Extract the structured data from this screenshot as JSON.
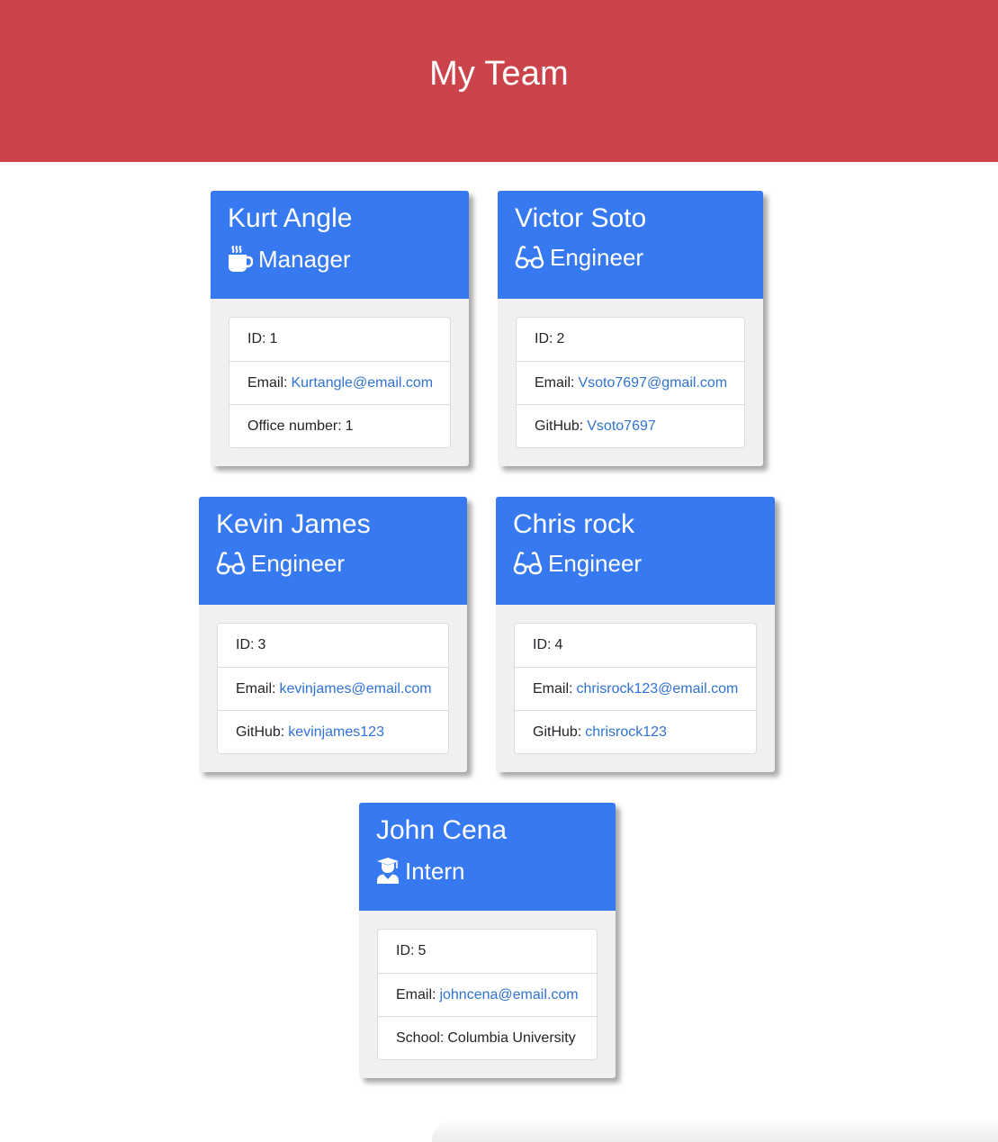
{
  "header": {
    "title": "My Team"
  },
  "cards": [
    {
      "name": "Kurt Angle",
      "role": "Manager",
      "icon": "mug-icon",
      "id_label": "ID:",
      "id_value": "1",
      "email_label": "Email:",
      "email_value": "Kurtangle@email.com",
      "extra_label": "Office number:",
      "extra_value": "1"
    },
    {
      "name": "Victor Soto",
      "role": "Engineer",
      "icon": "glasses-icon",
      "id_label": "ID:",
      "id_value": "2",
      "email_label": "Email:",
      "email_value": "Vsoto7697@gmail.com",
      "extra_label": "GitHub:",
      "extra_value": "Vsoto7697"
    },
    {
      "name": "Kevin James",
      "role": "Engineer",
      "icon": "glasses-icon",
      "id_label": "ID:",
      "id_value": "3",
      "email_label": "Email:",
      "email_value": "kevinjames@email.com",
      "extra_label": "GitHub:",
      "extra_value": "kevinjames123"
    },
    {
      "name": "Chris rock",
      "role": "Engineer",
      "icon": "glasses-icon",
      "id_label": "ID:",
      "id_value": "4",
      "email_label": "Email:",
      "email_value": "chrisrock123@email.com",
      "extra_label": "GitHub:",
      "extra_value": "chrisrock123"
    },
    {
      "name": "John Cena",
      "role": "Intern",
      "icon": "graduate-icon",
      "id_label": "ID:",
      "id_value": "5",
      "email_label": "Email:",
      "email_value": "johncena@email.com",
      "extra_label": "School:",
      "extra_value": "Columbia University"
    }
  ],
  "colors": {
    "header_bg": "#cb444c",
    "card_head_bg": "#3779f0",
    "card_body_bg": "#f0f0f0",
    "link": "#2f73d4"
  }
}
